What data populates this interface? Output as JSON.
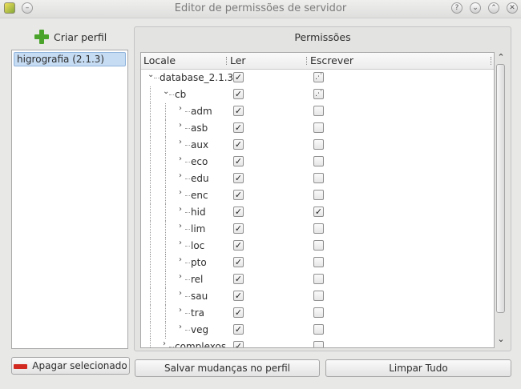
{
  "window": {
    "title": "Editor de permissões de servidor",
    "controls": [
      "help-icon",
      "minimize-icon",
      "maximize-icon",
      "close-icon"
    ]
  },
  "left": {
    "create_label": "Criar perfil",
    "profiles": [
      "higrografia (2.1.3)"
    ],
    "delete_label": "Apagar selecionado"
  },
  "permissions": {
    "group_title": "Permissões",
    "headers": [
      "Locale",
      "Ler",
      "Escrever"
    ],
    "rows": [
      {
        "name": "database_2.1.3",
        "level": 0,
        "ler": "checked",
        "escrever": "partial"
      },
      {
        "name": "cb",
        "level": 1,
        "ler": "checked",
        "escrever": "partial"
      },
      {
        "name": "adm",
        "level": 2,
        "ler": "checked",
        "escrever": "unchecked"
      },
      {
        "name": "asb",
        "level": 2,
        "ler": "checked",
        "escrever": "unchecked"
      },
      {
        "name": "aux",
        "level": 2,
        "ler": "checked",
        "escrever": "unchecked"
      },
      {
        "name": "eco",
        "level": 2,
        "ler": "checked",
        "escrever": "unchecked"
      },
      {
        "name": "edu",
        "level": 2,
        "ler": "checked",
        "escrever": "unchecked"
      },
      {
        "name": "enc",
        "level": 2,
        "ler": "checked",
        "escrever": "unchecked"
      },
      {
        "name": "hid",
        "level": 2,
        "ler": "checked",
        "escrever": "checked"
      },
      {
        "name": "lim",
        "level": 2,
        "ler": "checked",
        "escrever": "unchecked"
      },
      {
        "name": "loc",
        "level": 2,
        "ler": "checked",
        "escrever": "unchecked"
      },
      {
        "name": "pto",
        "level": 2,
        "ler": "checked",
        "escrever": "unchecked"
      },
      {
        "name": "rel",
        "level": 2,
        "ler": "checked",
        "escrever": "unchecked"
      },
      {
        "name": "sau",
        "level": 2,
        "ler": "checked",
        "escrever": "unchecked"
      },
      {
        "name": "tra",
        "level": 2,
        "ler": "checked",
        "escrever": "unchecked"
      },
      {
        "name": "veg",
        "level": 2,
        "ler": "checked",
        "escrever": "unchecked"
      },
      {
        "name": "complexos",
        "level": 1,
        "ler": "checked",
        "escrever": "unchecked"
      }
    ]
  },
  "buttons": {
    "save_label": "Salvar mudanças no perfil",
    "clear_label": "Limpar Tudo"
  },
  "colors": {
    "accent_green": "#4aa32a",
    "delete_red": "#d22a20",
    "selection": "#c6dcf3"
  }
}
